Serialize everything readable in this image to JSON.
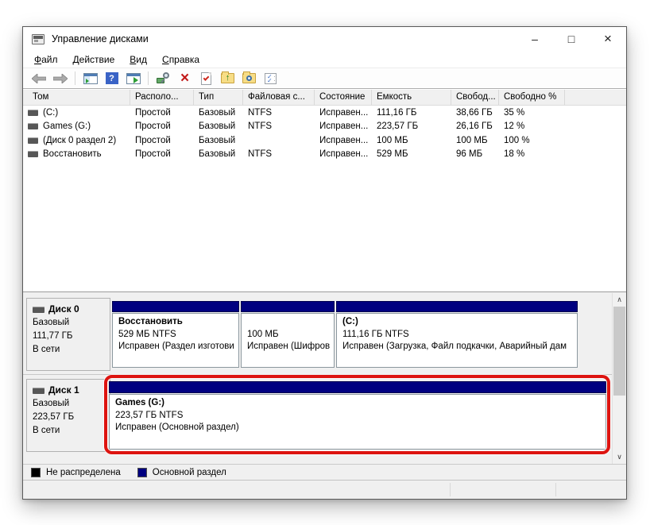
{
  "window": {
    "title": "Управление дисками",
    "controls": {
      "minimize": "–",
      "maximize": "□",
      "close": "×"
    }
  },
  "menu": {
    "items": [
      {
        "label": "Файл"
      },
      {
        "label": "Действие"
      },
      {
        "label": "Вид"
      },
      {
        "label": "Справка"
      }
    ]
  },
  "toolbar": {
    "icons": [
      "back-icon",
      "forward-icon",
      "show-console-tree-icon",
      "help-icon",
      "show-action-pane-icon",
      "rescan-disks-icon",
      "delete-icon",
      "check-document-icon",
      "folder-up-icon",
      "folder-search-icon",
      "checklist-icon"
    ],
    "help_glyph": "?"
  },
  "volumes_table": {
    "columns": [
      "Том",
      "Располо...",
      "Тип",
      "Файловая с...",
      "Состояние",
      "Емкость",
      "Свобод...",
      "Свободно %"
    ],
    "rows": [
      {
        "volume": "(C:)",
        "layout": "Простой",
        "type": "Базовый",
        "fs": "NTFS",
        "status": "Исправен...",
        "capacity": "111,16 ГБ",
        "free": "38,66 ГБ",
        "free_pct": "35 %"
      },
      {
        "volume": "Games (G:)",
        "layout": "Простой",
        "type": "Базовый",
        "fs": "NTFS",
        "status": "Исправен...",
        "capacity": "223,57 ГБ",
        "free": "26,16 ГБ",
        "free_pct": "12 %"
      },
      {
        "volume": "(Диск 0 раздел 2)",
        "layout": "Простой",
        "type": "Базовый",
        "fs": "",
        "status": "Исправен...",
        "capacity": "100 МБ",
        "free": "100 МБ",
        "free_pct": "100 %"
      },
      {
        "volume": "Восстановить",
        "layout": "Простой",
        "type": "Базовый",
        "fs": "NTFS",
        "status": "Исправен...",
        "capacity": "529 МБ",
        "free": "96 МБ",
        "free_pct": "18 %"
      }
    ]
  },
  "disks": [
    {
      "name": "Диск 0",
      "type": "Базовый",
      "size": "111,77 ГБ",
      "status": "В сети",
      "partitions": [
        {
          "name": "Восстановить",
          "size": "529 МБ NTFS",
          "status": "Исправен (Раздел изготови"
        },
        {
          "name": "",
          "size": "100 МБ",
          "status": "Исправен (Шифров"
        },
        {
          "name": "(C:)",
          "size": "111,16 ГБ NTFS",
          "status": "Исправен (Загрузка, Файл подкачки, Аварийный дам"
        }
      ]
    },
    {
      "name": "Диск 1",
      "type": "Базовый",
      "size": "223,57 ГБ",
      "status": "В сети",
      "partitions": [
        {
          "name": "Games  (G:)",
          "size": "223,57 ГБ NTFS",
          "status": "Исправен (Основной раздел)"
        }
      ]
    }
  ],
  "legend": {
    "items": [
      {
        "label": "Не распределена",
        "color": "#000000"
      },
      {
        "label": "Основной раздел",
        "color": "#000080"
      }
    ]
  },
  "colors": {
    "primary_partition_bar": "#000080",
    "annotation_highlight": "#dd1410"
  }
}
